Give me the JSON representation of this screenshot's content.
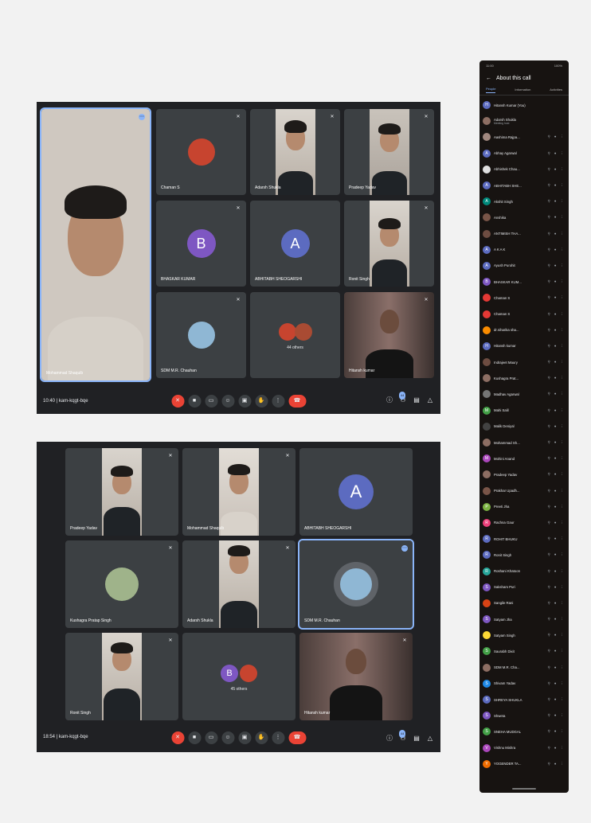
{
  "meeting1": {
    "time": "10:40",
    "code": "kam-kqgt-bqe",
    "participant_count": "44",
    "tiles": [
      {
        "name": "Mohammad Shaquib"
      },
      {
        "name": "Chaman S"
      },
      {
        "name": "Adarsh Shukla"
      },
      {
        "name": "Pradeep Yadav"
      },
      {
        "name": "BHASKAR KUMAR",
        "letter": "B"
      },
      {
        "name": "ABHITABH SHEOGARSHI",
        "letter": "A"
      },
      {
        "name": "Ronit Singh"
      },
      {
        "name": "SDM M.R. Chauhan"
      },
      {
        "name": "Hitansh kumar"
      }
    ],
    "others_label": "44 others"
  },
  "meeting2": {
    "time": "18:54",
    "code": "kam-kqgt-bqe",
    "participant_count": "44",
    "tiles": [
      {
        "name": "Pradeep Yadav"
      },
      {
        "name": "Mohammad Shaquib"
      },
      {
        "name": "ABHITABH SHEOGARSHI",
        "letter": "A"
      },
      {
        "name": "Kushagra Pratap Singh"
      },
      {
        "name": "Adarsh Shukla"
      },
      {
        "name": "SDM M.R. Chauhan"
      },
      {
        "name": "Ronit Singh"
      },
      {
        "name": "Hitansh kumar"
      }
    ],
    "others_label": "45 others",
    "others_letter": "B"
  },
  "phone": {
    "status_left": "11:00",
    "status_right": "100%",
    "title": "About this call",
    "tabs": [
      "People",
      "Information",
      "Activities"
    ],
    "people": [
      {
        "name": "Hitansh Kumar (You)",
        "letter": "H",
        "color": "#5c6bc0"
      },
      {
        "name": "Adarsh Shukla",
        "sub": "Meeting host",
        "letter": "",
        "color": "#8d6e63"
      },
      {
        "name": "Aashima Rajpa...",
        "letter": "",
        "color": "#a1887f"
      },
      {
        "name": "Abhay Agarwal",
        "letter": "A",
        "color": "#5c6bc0"
      },
      {
        "name": "Abhishek Chau...",
        "letter": "",
        "color": "#e0e0e0"
      },
      {
        "name": "ABHITABH SHE...",
        "letter": "A",
        "color": "#5c6bc0"
      },
      {
        "name": "Akshit Singh",
        "letter": "A",
        "color": "#00897b"
      },
      {
        "name": "Anshika",
        "letter": "",
        "color": "#795548"
      },
      {
        "name": "ANTIMISH THA...",
        "letter": "",
        "color": "#6d4c41"
      },
      {
        "name": "A K A K",
        "letter": "A",
        "color": "#5c6bc0"
      },
      {
        "name": "Ayush Purohit",
        "letter": "A",
        "color": "#5c6bc0"
      },
      {
        "name": "BHASKAR KUM...",
        "letter": "B",
        "color": "#7e57c2"
      },
      {
        "name": "Chaman S",
        "letter": "",
        "color": "#e53935"
      },
      {
        "name": "Chaman S",
        "letter": "",
        "color": "#e53935"
      },
      {
        "name": "dr.niharika sha...",
        "letter": "",
        "color": "#fb8c00"
      },
      {
        "name": "Hitansh kumar",
        "letter": "H",
        "color": "#5c6bc0"
      },
      {
        "name": "Indrajeet Maury",
        "letter": "",
        "color": "#6d4c41"
      },
      {
        "name": "Kushagra Prat...",
        "letter": "",
        "color": "#8d6e63"
      },
      {
        "name": "Madhav Agarwal",
        "letter": "",
        "color": "#757575"
      },
      {
        "name": "Mahi Salil",
        "letter": "M",
        "color": "#43a047"
      },
      {
        "name": "Malik Deniyal",
        "letter": "",
        "color": "#424242"
      },
      {
        "name": "Mohammad Sh...",
        "letter": "",
        "color": "#8d6e63"
      },
      {
        "name": "Mohini Anand",
        "letter": "M",
        "color": "#ab47bc"
      },
      {
        "name": "Pradeep Yadav",
        "letter": "",
        "color": "#8d6e63"
      },
      {
        "name": "Prakhar Upadh...",
        "letter": "",
        "color": "#795548"
      },
      {
        "name": "Preeti Jha",
        "letter": "P",
        "color": "#7cb342"
      },
      {
        "name": "Rachna Gaur",
        "letter": "R",
        "color": "#ec407a"
      },
      {
        "name": "ROHIT BHUKU",
        "letter": "R",
        "color": "#5c6bc0"
      },
      {
        "name": "Ronit Singh",
        "letter": "R",
        "color": "#5c6bc0"
      },
      {
        "name": "Roshani Khatoon",
        "letter": "R",
        "color": "#26a69a"
      },
      {
        "name": "Saksham Puri",
        "letter": "S",
        "color": "#7e57c2"
      },
      {
        "name": "Sangile Rani",
        "letter": "",
        "color": "#d84315"
      },
      {
        "name": "Satyam Jha",
        "letter": "S",
        "color": "#7e57c2"
      },
      {
        "name": "Satyam Singh",
        "letter": "",
        "color": "#fdd835"
      },
      {
        "name": "Saurabh Dixit",
        "letter": "S",
        "color": "#43a047"
      },
      {
        "name": "SDM M.R. Cha...",
        "letter": "",
        "color": "#8d6e63"
      },
      {
        "name": "Shivam Yadav",
        "letter": "S",
        "color": "#1e88e5"
      },
      {
        "name": "SHREYA SHUKLA",
        "letter": "S",
        "color": "#5c6bc0"
      },
      {
        "name": "Shweta",
        "letter": "S",
        "color": "#7e57c2"
      },
      {
        "name": "SNEHA MUDGAL",
        "letter": "S",
        "color": "#43a047"
      },
      {
        "name": "Vishnu Mishra",
        "letter": "V",
        "color": "#ab47bc"
      },
      {
        "name": "YOGENDER TA...",
        "letter": "Y",
        "color": "#ef6c00"
      }
    ]
  }
}
